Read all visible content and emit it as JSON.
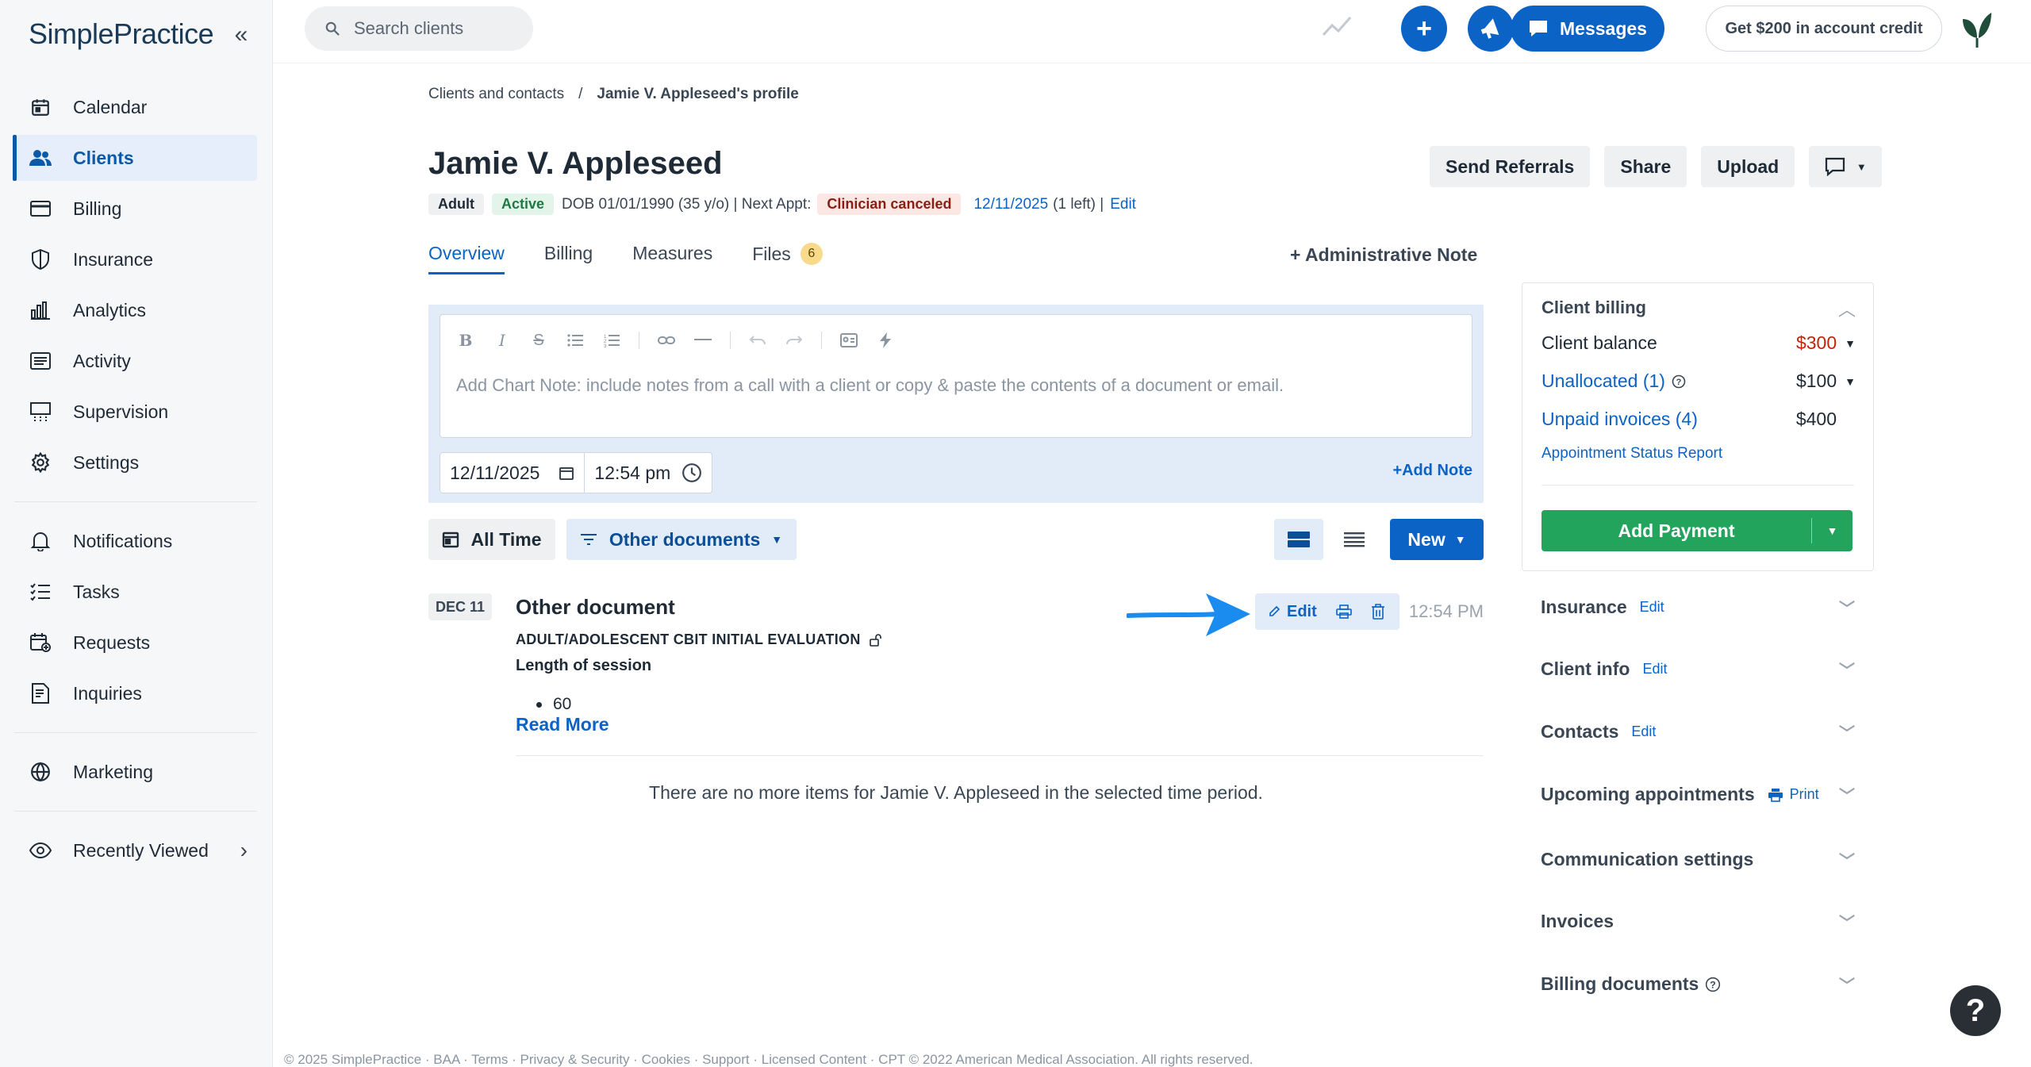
{
  "brand": {
    "name_part1": "Simple",
    "name_part2": "Practice"
  },
  "sidebar": {
    "items": [
      {
        "label": "Calendar",
        "icon": "calendar-icon"
      },
      {
        "label": "Clients",
        "icon": "clients-icon",
        "active": true
      },
      {
        "label": "Billing",
        "icon": "billing-card-icon"
      },
      {
        "label": "Insurance",
        "icon": "shield-icon"
      },
      {
        "label": "Analytics",
        "icon": "bar-chart-icon"
      },
      {
        "label": "Activity",
        "icon": "activity-list-icon"
      },
      {
        "label": "Supervision",
        "icon": "supervision-icon"
      },
      {
        "label": "Settings",
        "icon": "gear-icon"
      }
    ],
    "items2": [
      {
        "label": "Notifications",
        "icon": "bell-icon"
      },
      {
        "label": "Tasks",
        "icon": "tasks-icon"
      },
      {
        "label": "Requests",
        "icon": "requests-icon"
      },
      {
        "label": "Inquiries",
        "icon": "inquiries-icon"
      }
    ],
    "marketing": "Marketing",
    "recently_viewed": "Recently Viewed"
  },
  "topbar": {
    "search_placeholder": "Search clients",
    "messages_label": "Messages",
    "credit_label": "Get $200 in account credit"
  },
  "breadcrumb": {
    "parent": "Clients and contacts",
    "separator": "/",
    "current": "Jamie V. Appleseed's profile"
  },
  "client": {
    "name": "Jamie V. Appleseed",
    "tag_adult": "Adult",
    "tag_status": "Active",
    "dob_text": "DOB 01/01/1990 (35 y/o) | Next Appt:",
    "appt_status": "Clinician canceled",
    "appt_date": "12/11/2025",
    "appt_left": "(1 left) |",
    "edit": "Edit"
  },
  "header_actions": {
    "send_referrals": "Send Referrals",
    "share": "Share",
    "upload": "Upload"
  },
  "tabs": [
    {
      "label": "Overview",
      "active": true
    },
    {
      "label": "Billing"
    },
    {
      "label": "Measures"
    },
    {
      "label": "Files",
      "count": "6"
    }
  ],
  "admin_note": "+ Administrative Note",
  "note_editor": {
    "placeholder": "Add Chart Note: include notes from a call with a client or copy & paste the contents of a document or email.",
    "date": "12/11/2025",
    "time": "12:54 pm",
    "add_note": "+Add Note"
  },
  "filters": {
    "all_time": "All Time",
    "other_documents": "Other documents",
    "new": "New"
  },
  "document": {
    "date": "DEC 11",
    "title": "Other document",
    "form_name": "ADULT/ADOLESCENT CBIT INITIAL EVALUATION",
    "field_label": "Length of session",
    "field_value": "60",
    "read_more": "Read More",
    "edit": "Edit",
    "time": "12:54 PM"
  },
  "no_more_text": "There are no more items for Jamie V. Appleseed in the selected time period.",
  "billing": {
    "title": "Client billing",
    "balance_label": "Client balance",
    "balance_value": "$300",
    "unallocated_label": "Unallocated (1)",
    "unallocated_value": "$100",
    "unpaid_label": "Unpaid invoices (4)",
    "unpaid_value": "$400",
    "status_report": "Appointment Status Report",
    "add_payment": "Add Payment"
  },
  "right_sections": {
    "insurance": "Insurance",
    "insurance_edit": "Edit",
    "client_info": "Client info",
    "client_info_edit": "Edit",
    "contacts": "Contacts",
    "contacts_edit": "Edit",
    "upcoming": "Upcoming appointments",
    "upcoming_print": "Print",
    "communication": "Communication settings",
    "invoices": "Invoices",
    "billing_documents": "Billing documents"
  },
  "help": "?",
  "footer": "© 2025 SimplePractice · BAA · Terms · Privacy & Security · Cookies · Support · Licensed Content · CPT © 2022 American Medical Association. All rights reserved.",
  "colors": {
    "primary": "#0b63c5",
    "active_nav_bg": "#e6eefb",
    "success": "#22a45d",
    "danger": "#c0250c"
  }
}
